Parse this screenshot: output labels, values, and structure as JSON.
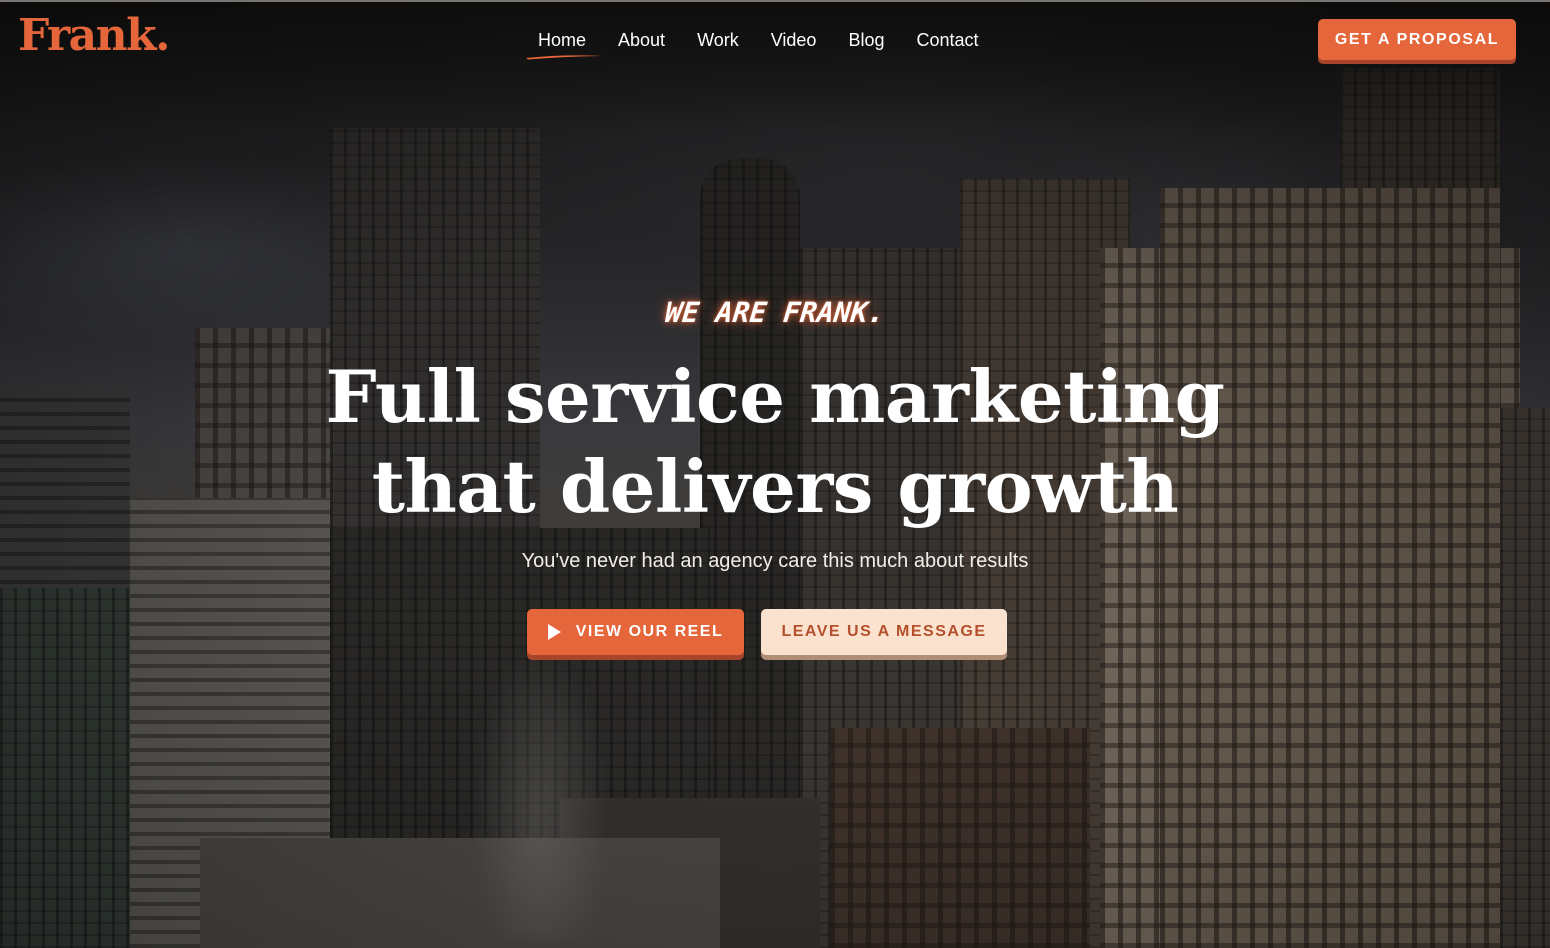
{
  "brand": {
    "logo_text": "Frank.",
    "accent_color": "#e4663a",
    "accent_light": "#fbe2cf"
  },
  "nav": {
    "items": [
      {
        "label": "Home",
        "active": true
      },
      {
        "label": "About",
        "active": false
      },
      {
        "label": "Work",
        "active": false
      },
      {
        "label": "Video",
        "active": false
      },
      {
        "label": "Blog",
        "active": false
      },
      {
        "label": "Contact",
        "active": false
      }
    ],
    "cta_label": "GET A PROPOSAL"
  },
  "hero": {
    "eyebrow": "WE ARE FRANK.",
    "headline_line1": "Full service marketing",
    "headline_line2": "that delivers growth",
    "subhead": "You've never had an agency care this much about results",
    "primary_button": {
      "label": "VIEW OUR REEL",
      "icon": "play-icon"
    },
    "secondary_button": {
      "label": "LEAVE US A MESSAGE"
    }
  }
}
